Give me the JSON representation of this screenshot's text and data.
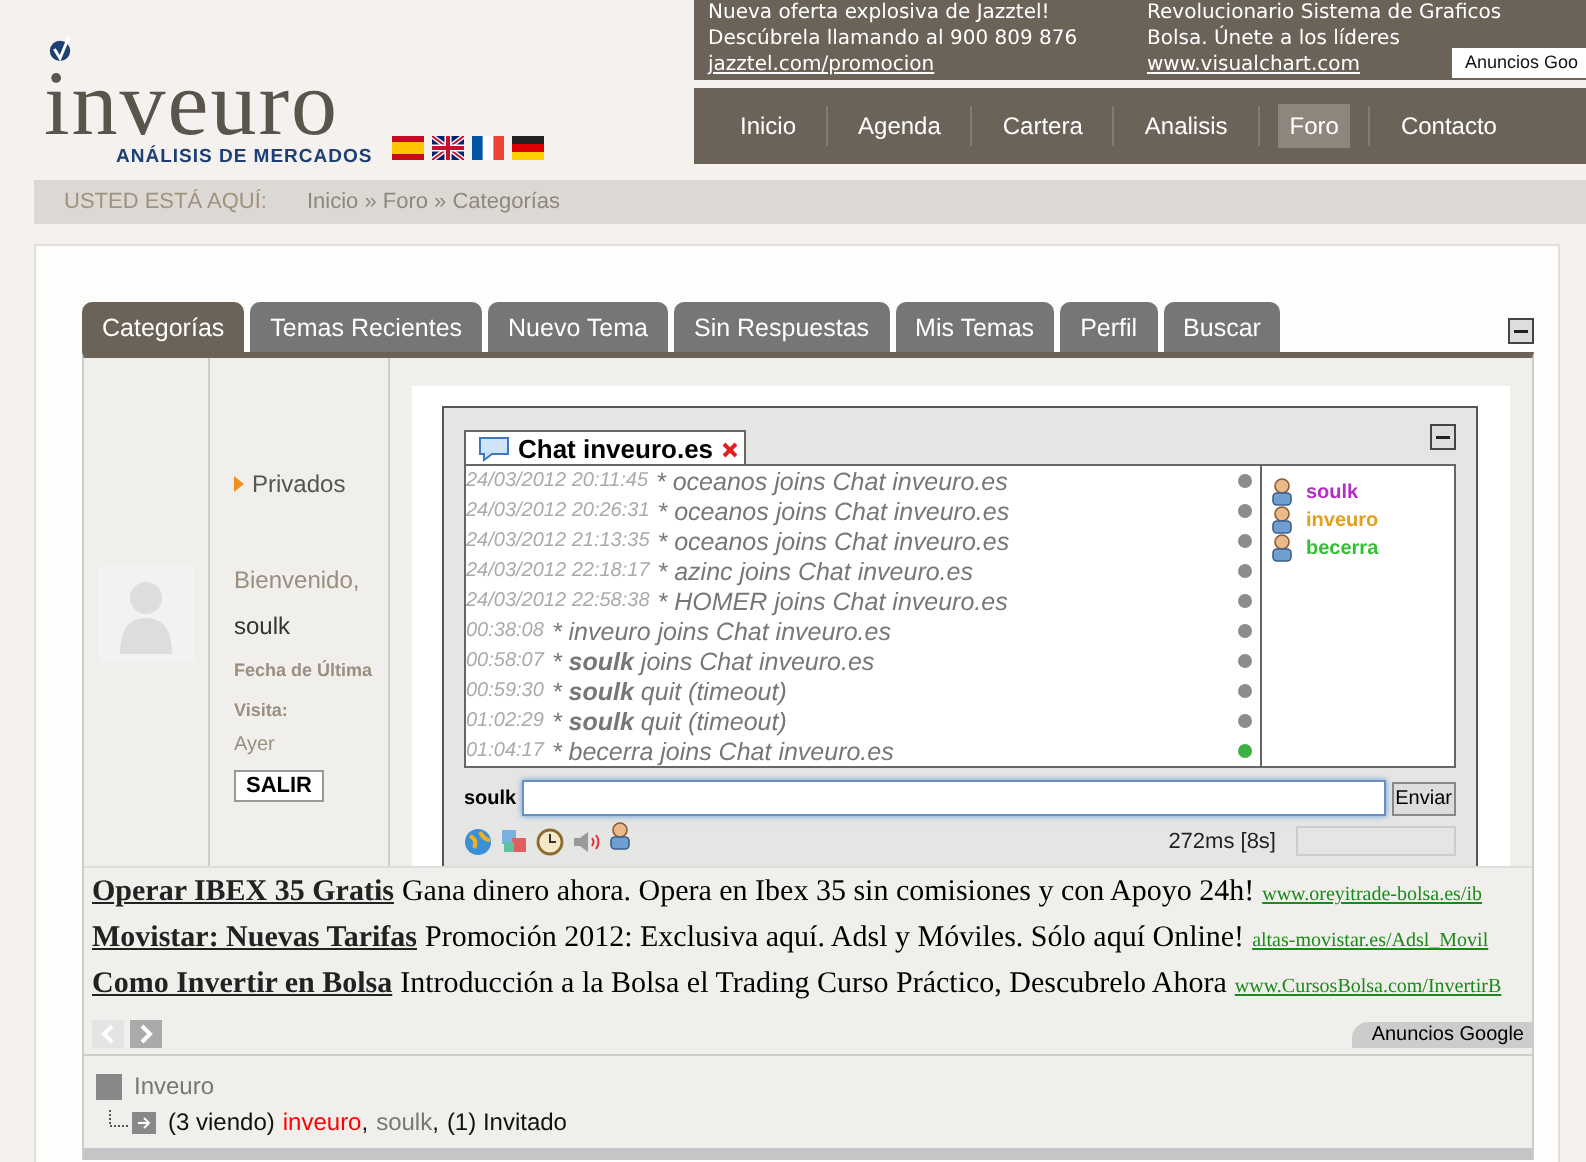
{
  "header": {
    "logo": {
      "name": "inveuro",
      "tagline": "ANÁLISIS DE MERCADOS"
    },
    "top_ads": [
      {
        "lines": [
          "Nueva oferta explosiva de Jazztel!",
          "Descúbrela llamando al 900 809 876"
        ],
        "url": "jazztel.com/promocion"
      },
      {
        "lines": [
          "Revolucionario Sistema de Graficos",
          "Bolsa. Únete a los líderes"
        ],
        "url": "www.visualchart.com"
      }
    ],
    "ads_label": "Anuncios Goo",
    "nav": [
      {
        "label": "Inicio",
        "selected": false
      },
      {
        "label": "Agenda",
        "selected": false
      },
      {
        "label": "Cartera",
        "selected": false
      },
      {
        "label": "Analisis",
        "selected": false
      },
      {
        "label": "Foro",
        "selected": true
      },
      {
        "label": "Contacto",
        "selected": false
      }
    ]
  },
  "breadcrumb": {
    "label": "USTED ESTÁ AQUÍ:",
    "path": "Inicio » Foro » Categorías"
  },
  "tabs": [
    {
      "label": "Categorías",
      "selected": true
    },
    {
      "label": "Temas Recientes",
      "selected": false
    },
    {
      "label": "Nuevo Tema",
      "selected": false
    },
    {
      "label": "Sin Respuestas",
      "selected": false
    },
    {
      "label": "Mis Temas",
      "selected": false
    },
    {
      "label": "Perfil",
      "selected": false
    },
    {
      "label": "Buscar",
      "selected": false
    }
  ],
  "sidebar": {
    "link": "Privados",
    "greeting": "Bienvenido,",
    "user": "soulk",
    "last_visit_label": "Fecha de Última Visita:",
    "last_visit": "Ayer",
    "logout": "SALIR"
  },
  "chat": {
    "title": "Chat inveuro.es",
    "messages": [
      {
        "time": "24/03/2012 20:11:45",
        "text": "* oceanos joins Chat inveuro.es",
        "color": "#8c8c8c"
      },
      {
        "time": "24/03/2012 20:26:31",
        "text": "* oceanos joins Chat inveuro.es",
        "color": "#8c8c8c"
      },
      {
        "time": "24/03/2012 21:13:35",
        "text": "* oceanos joins Chat inveuro.es",
        "color": "#8c8c8c"
      },
      {
        "time": "24/03/2012 22:18:17",
        "text": "* azinc joins Chat inveuro.es",
        "color": "#8c8c8c"
      },
      {
        "time": "24/03/2012 22:58:38",
        "text": "* HOMER joins Chat inveuro.es",
        "color": "#8c8c8c"
      },
      {
        "time": "00:38:08",
        "text": "* inveuro joins Chat inveuro.es",
        "color": "#8c8c8c"
      },
      {
        "time": "00:58:07",
        "text": "* **soulk** joins Chat inveuro.es",
        "color": "#8c8c8c"
      },
      {
        "time": "00:59:30",
        "text": "* **soulk** quit (timeout)",
        "color": "#8c8c8c"
      },
      {
        "time": "01:02:29",
        "text": "* **soulk** quit (timeout)",
        "color": "#8c8c8c"
      },
      {
        "time": "01:04:17",
        "text": "* becerra joins Chat inveuro.es",
        "color": "#3cb043"
      }
    ],
    "users": [
      {
        "name": "soulk",
        "color": "#b030c0"
      },
      {
        "name": "inveuro",
        "color": "#e0a020"
      },
      {
        "name": "becerra",
        "color": "#33c033"
      }
    ],
    "nick": "soulk",
    "send": "Enviar",
    "ping": "272ms [8s]"
  },
  "ads": {
    "items": [
      {
        "title": "Operar IBEX 35 Gratis",
        "text": "Gana dinero ahora. Opera en Ibex 35 sin comisiones y con Apoyo 24h!",
        "url": "www.oreyitrade-bolsa.es/ib"
      },
      {
        "title": "Movistar: Nuevas Tarifas",
        "text": "Promoción 2012: Exclusiva aquí. Adsl y Móviles. Sólo aquí Online!",
        "url": "altas-movistar.es/Adsl_Movil"
      },
      {
        "title": "Como Invertir en Bolsa",
        "text": "Introducción a la Bolsa el Trading Curso Práctico, Descubrelo Ahora",
        "url": "www.CursosBolsa.com/InvertirB"
      }
    ],
    "label": "Anuncios Google"
  },
  "stats": {
    "forum": "Inveuro",
    "viewing": "(3 viendo)",
    "users": [
      {
        "name": "inveuro",
        "color": "#ff0000",
        "suffix": ","
      },
      {
        "name": "soulk",
        "color": "#777777",
        "suffix": ","
      }
    ],
    "guests": "(1) Invitado"
  }
}
